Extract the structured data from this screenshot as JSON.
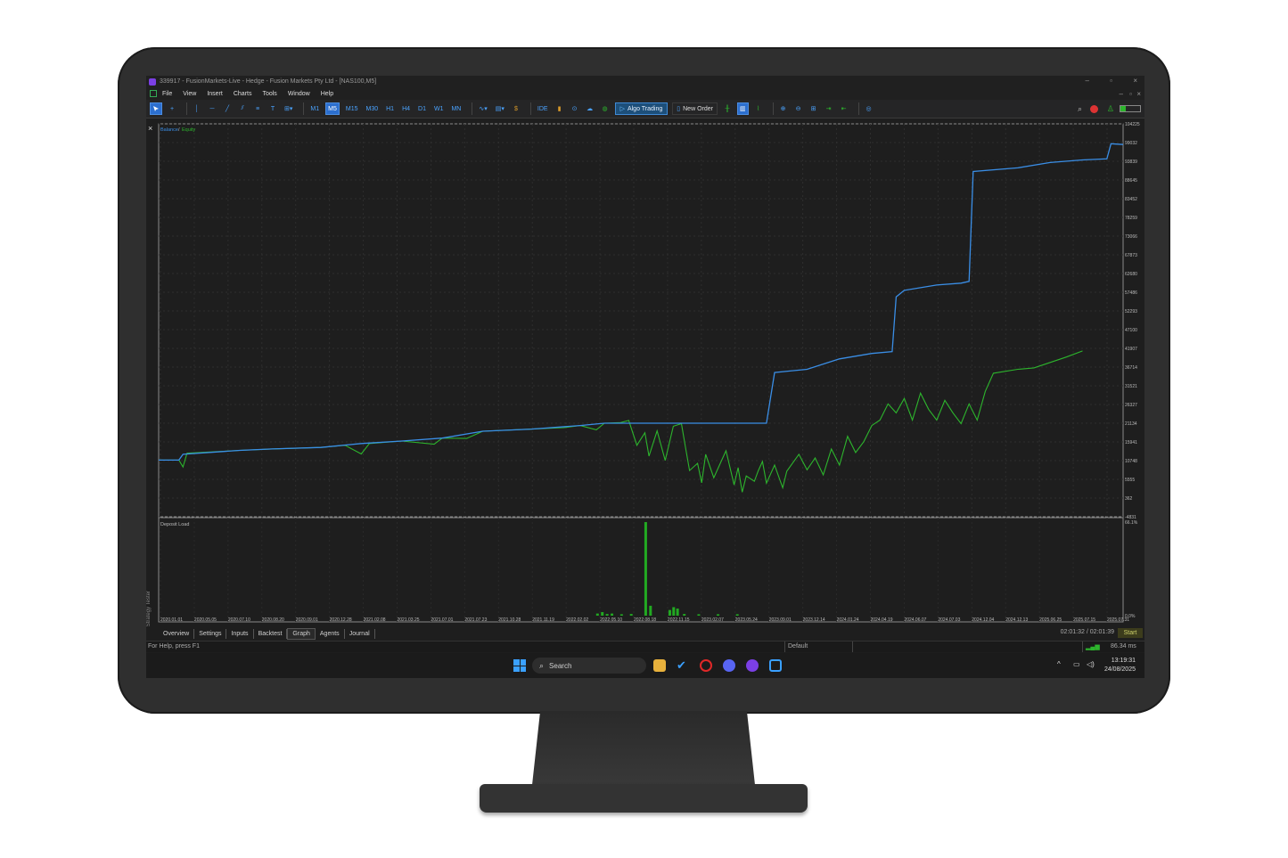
{
  "window": {
    "title": "339917 - FusionMarkets-Live - Hedge - Fusion Markets Pty Ltd - [NAS100,M5]",
    "controls": [
      "–",
      "▫",
      "×"
    ]
  },
  "menu": [
    "File",
    "View",
    "Insert",
    "Charts",
    "Tools",
    "Window",
    "Help"
  ],
  "toolbar": {
    "timeframes": [
      "M1",
      "M5",
      "M15",
      "M30",
      "H1",
      "H4",
      "D1",
      "W1",
      "MN"
    ],
    "active_timeframe": "M5",
    "ide_label": "IDE",
    "algo_trading_label": "Algo Trading",
    "new_order_label": "New Order"
  },
  "chart_data": [
    {
      "type": "line",
      "legend": [
        "Balance",
        "Equity"
      ],
      "legend_separator": "/",
      "y_ticks": [
        "104225",
        "99032",
        "93839",
        "88645",
        "83452",
        "78259",
        "73066",
        "67873",
        "62680",
        "57486",
        "52293",
        "47100",
        "41907",
        "36714",
        "31521",
        "26327",
        "21134",
        "15941",
        "10748",
        "5555",
        "362",
        "-4831"
      ],
      "ylim": [
        -4831,
        104225
      ],
      "series": [
        {
          "name": "Balance",
          "color": "#3a8ee6",
          "points": [
            [
              0,
              10900
            ],
            [
              0.025,
              10900
            ],
            [
              0.03,
              12500
            ],
            [
              0.1,
              13600
            ],
            [
              0.14,
              14000
            ],
            [
              0.2,
              14400
            ],
            [
              0.25,
              15500
            ],
            [
              0.3,
              16200
            ],
            [
              0.35,
              17000
            ],
            [
              0.4,
              18900
            ],
            [
              0.46,
              19500
            ],
            [
              0.52,
              20500
            ],
            [
              0.55,
              21134
            ],
            [
              0.6,
              21134
            ],
            [
              0.66,
              21134
            ],
            [
              0.7,
              21134
            ],
            [
              0.745,
              21134
            ],
            [
              0.75,
              21134
            ],
            [
              0.76,
              35200
            ],
            [
              0.8,
              36100
            ],
            [
              0.84,
              39000
            ],
            [
              0.88,
              40500
            ],
            [
              0.905,
              41000
            ],
            [
              0.91,
              56200
            ],
            [
              0.92,
              58000
            ],
            [
              0.96,
              59500
            ],
            [
              0.99,
              60000
            ],
            [
              1.0,
              60500
            ],
            [
              1.005,
              91000
            ],
            [
              1.06,
              92000
            ],
            [
              1.1,
              93500
            ],
            [
              1.14,
              94200
            ],
            [
              1.17,
              94500
            ],
            [
              1.175,
              98700
            ],
            [
              1.19,
              98500
            ]
          ]
        },
        {
          "name": "Equity",
          "color": "#2db52d",
          "points": [
            [
              0,
              10900
            ],
            [
              0.025,
              10900
            ],
            [
              0.03,
              9000
            ],
            [
              0.035,
              12800
            ],
            [
              0.1,
              13600
            ],
            [
              0.14,
              14000
            ],
            [
              0.2,
              14400
            ],
            [
              0.23,
              15000
            ],
            [
              0.25,
              12600
            ],
            [
              0.26,
              15500
            ],
            [
              0.3,
              16200
            ],
            [
              0.34,
              15300
            ],
            [
              0.35,
              17000
            ],
            [
              0.38,
              16900
            ],
            [
              0.4,
              18900
            ],
            [
              0.46,
              19500
            ],
            [
              0.5,
              19900
            ],
            [
              0.52,
              20500
            ],
            [
              0.54,
              19300
            ],
            [
              0.55,
              21134
            ],
            [
              0.57,
              21300
            ],
            [
              0.58,
              21900
            ],
            [
              0.59,
              15000
            ],
            [
              0.6,
              18500
            ],
            [
              0.605,
              12000
            ],
            [
              0.615,
              19000
            ],
            [
              0.625,
              10800
            ],
            [
              0.635,
              20300
            ],
            [
              0.645,
              21000
            ],
            [
              0.65,
              14500
            ],
            [
              0.655,
              8000
            ],
            [
              0.665,
              10000
            ],
            [
              0.67,
              4600
            ],
            [
              0.675,
              12500
            ],
            [
              0.685,
              6000
            ],
            [
              0.695,
              11000
            ],
            [
              0.7,
              13500
            ],
            [
              0.71,
              4000
            ],
            [
              0.715,
              8800
            ],
            [
              0.72,
              2000
            ],
            [
              0.725,
              6500
            ],
            [
              0.735,
              5000
            ],
            [
              0.74,
              8000
            ],
            [
              0.745,
              10500
            ],
            [
              0.75,
              4500
            ],
            [
              0.76,
              9500
            ],
            [
              0.77,
              3200
            ],
            [
              0.775,
              7800
            ],
            [
              0.79,
              12500
            ],
            [
              0.8,
              8200
            ],
            [
              0.81,
              11500
            ],
            [
              0.82,
              6800
            ],
            [
              0.83,
              14000
            ],
            [
              0.84,
              9500
            ],
            [
              0.85,
              17500
            ],
            [
              0.86,
              13000
            ],
            [
              0.87,
              16000
            ],
            [
              0.88,
              20500
            ],
            [
              0.89,
              22000
            ],
            [
              0.9,
              26500
            ],
            [
              0.91,
              24000
            ],
            [
              0.92,
              28000
            ],
            [
              0.93,
              22000
            ],
            [
              0.94,
              29500
            ],
            [
              0.95,
              25000
            ],
            [
              0.96,
              22000
            ],
            [
              0.97,
              27500
            ],
            [
              0.98,
              24000
            ],
            [
              0.99,
              21000
            ],
            [
              1.0,
              26500
            ],
            [
              1.01,
              22000
            ],
            [
              1.02,
              30000
            ],
            [
              1.03,
              35000
            ],
            [
              1.06,
              36100
            ],
            [
              1.08,
              36500
            ],
            [
              1.1,
              38000
            ],
            [
              1.12,
              39500
            ],
            [
              1.14,
              41200
            ]
          ]
        }
      ]
    },
    {
      "type": "bar",
      "title": "Deposit Load",
      "y_ticks": [
        "66.1%",
        "0.0%"
      ],
      "ylim": [
        0,
        66.1
      ],
      "x_ticks": [
        "2020.01.01",
        "2020.05.05",
        "2020.07.10",
        "2020.08.20",
        "2020.09.01",
        "2020.12.28",
        "2021.02.08",
        "2021.03.25",
        "2021.07.01",
        "2021.07.23",
        "2021.10.28",
        "2021.11.19",
        "2022.02.02",
        "2022.05.10",
        "2022.08.18",
        "2022.11.15",
        "2023.02.07",
        "2023.05.24",
        "2023.09.01",
        "2023.12.14",
        "2024.01.24",
        "2024.04.19",
        "2024.06.07",
        "2024.07.03",
        "2024.12.04",
        "2024.12.13",
        "2025.06.25",
        "2025.07.15",
        "2025.07.31"
      ],
      "bars": [
        {
          "x": 0.455,
          "value": 1.5
        },
        {
          "x": 0.46,
          "value": 2.5
        },
        {
          "x": 0.465,
          "value": 1.2
        },
        {
          "x": 0.47,
          "value": 1.5
        },
        {
          "x": 0.48,
          "value": 1.0
        },
        {
          "x": 0.49,
          "value": 1.2
        },
        {
          "x": 0.505,
          "value": 66.1
        },
        {
          "x": 0.51,
          "value": 7.0
        },
        {
          "x": 0.53,
          "value": 4.0
        },
        {
          "x": 0.534,
          "value": 6.0
        },
        {
          "x": 0.538,
          "value": 5.0
        },
        {
          "x": 0.545,
          "value": 1.2
        },
        {
          "x": 0.56,
          "value": 1.0
        },
        {
          "x": 0.58,
          "value": 1.0
        },
        {
          "x": 0.6,
          "value": 1.0
        }
      ],
      "color": "#22aa22"
    }
  ],
  "chart": {
    "close_icon": "×",
    "side_label": "Strategy Tester"
  },
  "tester_tabs": [
    "Overview",
    "Settings",
    "Inputs",
    "Backtest",
    "Graph",
    "Agents",
    "Journal"
  ],
  "active_tab": "Graph",
  "timer_text": "02:01:32 / 02:01:39",
  "start_label": "Start",
  "status": {
    "help": "For Help, press F1",
    "profile": "Default",
    "ping": "86.34 ms"
  },
  "taskbar": {
    "search_label": "Search",
    "time": "13:19:31",
    "date": "24/08/2025"
  },
  "colors": {
    "balance": "#3a8ee6",
    "equity": "#2db52d",
    "accent": "#2c6fcf"
  }
}
